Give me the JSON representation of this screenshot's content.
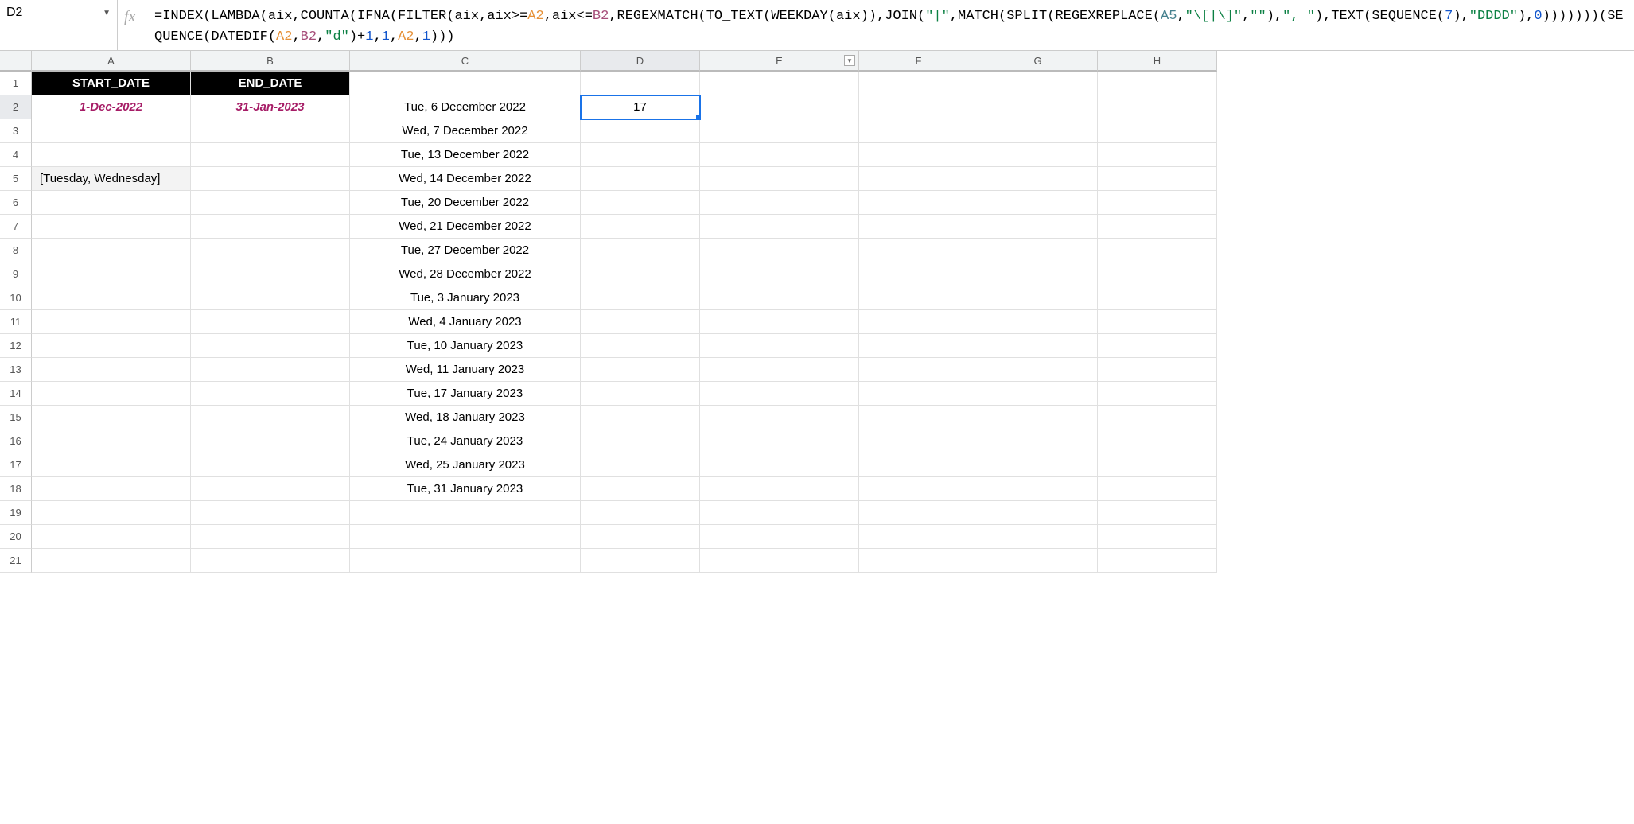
{
  "name_box": "D2",
  "fx_label": "fx",
  "formula": {
    "parts": [
      {
        "t": "=INDEX(LAMBDA(aix,COUNTA(IFNA(FILTER(aix,aix>="
      },
      {
        "t": "A2",
        "c": "tok-ref-a2"
      },
      {
        "t": ",aix<="
      },
      {
        "t": "B2",
        "c": "tok-ref-b2"
      },
      {
        "t": ",REGEXMATCH(TO_TEXT(WEEKDAY(aix)),JOIN("
      },
      {
        "t": "\"|\"",
        "c": "tok-str"
      },
      {
        "t": ",MATCH(SPLIT(REGEXREPLACE("
      },
      {
        "t": "A5",
        "c": "tok-ref-a5"
      },
      {
        "t": ","
      },
      {
        "t": "\"\\[|\\]\"",
        "c": "tok-str"
      },
      {
        "t": ","
      },
      {
        "t": "\"\"",
        "c": "tok-str"
      },
      {
        "t": "),"
      },
      {
        "t": "\", \"",
        "c": "tok-str"
      },
      {
        "t": "),TEXT(SEQUENCE("
      },
      {
        "t": "7",
        "c": "tok-num"
      },
      {
        "t": "),"
      },
      {
        "t": "\"DDDD\"",
        "c": "tok-str"
      },
      {
        "t": "),"
      },
      {
        "t": "0",
        "c": "tok-num"
      },
      {
        "t": ")))))))(SEQUENCE(DATEDIF("
      },
      {
        "t": "A2",
        "c": "tok-ref-a2"
      },
      {
        "t": ","
      },
      {
        "t": "B2",
        "c": "tok-ref-b2"
      },
      {
        "t": ","
      },
      {
        "t": "\"d\"",
        "c": "tok-str"
      },
      {
        "t": ")+"
      },
      {
        "t": "1",
        "c": "tok-num"
      },
      {
        "t": ","
      },
      {
        "t": "1",
        "c": "tok-num"
      },
      {
        "t": ","
      },
      {
        "t": "A2",
        "c": "tok-ref-a2"
      },
      {
        "t": ","
      },
      {
        "t": "1",
        "c": "tok-num"
      },
      {
        "t": ")))"
      }
    ]
  },
  "columns": [
    "A",
    "B",
    "C",
    "D",
    "E",
    "F",
    "G",
    "H"
  ],
  "selected_col": "D",
  "selected_row": 2,
  "row_count": 21,
  "headers": {
    "A1": "START_DATE",
    "B1": "END_DATE"
  },
  "cells": {
    "A2": "1-Dec-2022",
    "B2": "31-Jan-2023",
    "A5": "[Tuesday, Wednesday]",
    "D2": "17",
    "C": [
      "Tue, 6 December 2022",
      "Wed, 7 December 2022",
      "Tue, 13 December 2022",
      "Wed, 14 December 2022",
      "Tue, 20 December 2022",
      "Wed, 21 December 2022",
      "Tue, 27 December 2022",
      "Wed, 28 December 2022",
      "Tue, 3 January 2023",
      "Wed, 4 January 2023",
      "Tue, 10 January 2023",
      "Wed, 11 January 2023",
      "Tue, 17 January 2023",
      "Wed, 18 January 2023",
      "Tue, 24 January 2023",
      "Wed, 25 January 2023",
      "Tue, 31 January 2023"
    ]
  }
}
